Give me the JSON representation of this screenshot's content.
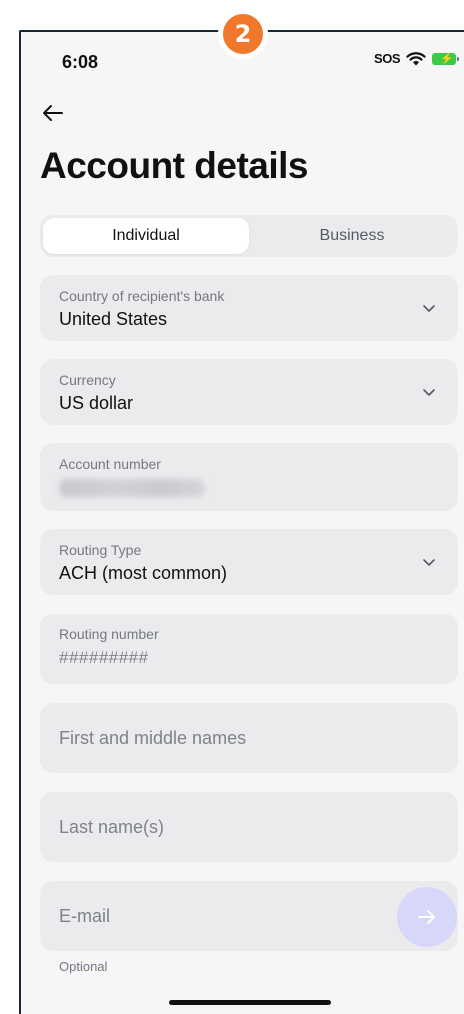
{
  "step_badge": "2",
  "status_bar": {
    "time": "6:08",
    "sos": "SOS"
  },
  "page": {
    "title": "Account details"
  },
  "tabs": [
    {
      "label": "Individual",
      "selected": true
    },
    {
      "label": "Business",
      "selected": false
    }
  ],
  "fields": {
    "country": {
      "label": "Country of recipient's bank",
      "value": "United States"
    },
    "currency": {
      "label": "Currency",
      "value": "US dollar"
    },
    "account_number": {
      "label": "Account number",
      "value_obscured": true
    },
    "routing_type": {
      "label": "Routing Type",
      "value": "ACH (most common)"
    },
    "routing_number": {
      "label": "Routing number",
      "value": "#########"
    },
    "first_names": {
      "placeholder": "First and middle names"
    },
    "last_name": {
      "placeholder": "Last name(s)"
    },
    "email": {
      "placeholder": "E-mail",
      "helper": "Optional"
    }
  },
  "colors": {
    "badge": "#f0782d",
    "background": "#f6f6f7",
    "field": "#ebebed",
    "next_button": "#d7d8f9"
  },
  "icons": [
    "back-arrow-icon",
    "wifi-icon",
    "battery-charging-icon",
    "chevron-down-icon",
    "arrow-right-icon"
  ]
}
